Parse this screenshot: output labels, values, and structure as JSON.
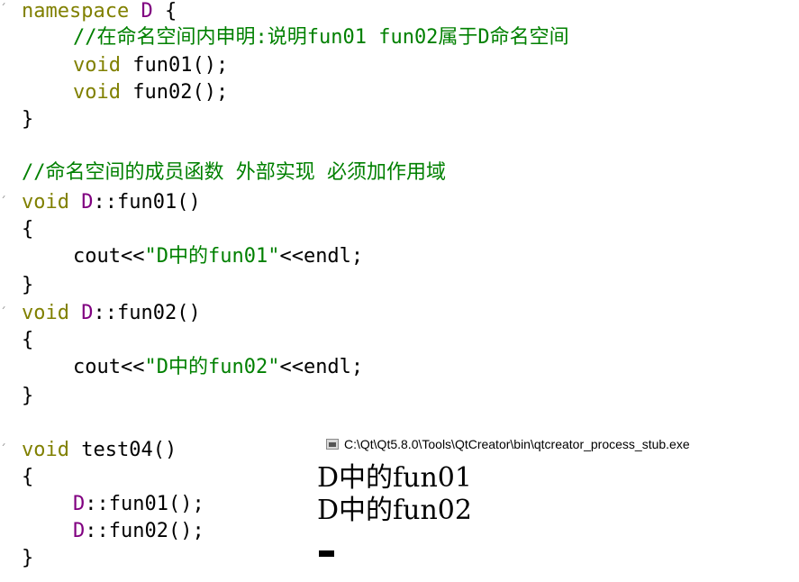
{
  "editor": {
    "lines": {
      "l1": {
        "kw": "namespace",
        "ns": "D",
        "rest": " {"
      },
      "l2": {
        "comment": "//在命名空间内申明:说明fun01 fun02属于D命名空间"
      },
      "l3": {
        "kw": "void",
        "fn": " fun01();"
      },
      "l4": {
        "kw": "void",
        "fn": " fun02();"
      },
      "l5": {
        "text": "}"
      },
      "l6": {
        "comment": "//命名空间的成员函数 外部实现 必须加作用域"
      },
      "l7": {
        "kw": "void",
        "ns": "D",
        "rest": "::fun01()"
      },
      "l8": {
        "text": "{"
      },
      "l9": {
        "pre": "cout<<",
        "str": "\"D中的fun01\"",
        "post": "<<endl;"
      },
      "l10": {
        "text": "}"
      },
      "l11": {
        "kw": "void",
        "ns": "D",
        "rest": "::fun02()"
      },
      "l12": {
        "text": "{"
      },
      "l13": {
        "pre": "cout<<",
        "str": "\"D中的fun02\"",
        "post": "<<endl;"
      },
      "l14": {
        "text": "}"
      },
      "l15": {
        "kw": "void",
        "rest": " test04()"
      },
      "l16": {
        "text": "{"
      },
      "l17": {
        "ns": "D",
        "rest": "::fun01();"
      },
      "l18": {
        "ns": "D",
        "rest": "::fun02();"
      },
      "l19": {
        "text": "}"
      }
    },
    "colors": {
      "keyword": "#808000",
      "namespace": "#800080",
      "comment": "#008000",
      "string": "#008000"
    }
  },
  "console": {
    "title": "C:\\Qt\\Qt5.8.0\\Tools\\QtCreator\\bin\\qtcreator_process_stub.exe",
    "output": [
      "D中的fun01",
      "D中的fun02"
    ],
    "icon": "console-window-icon"
  }
}
